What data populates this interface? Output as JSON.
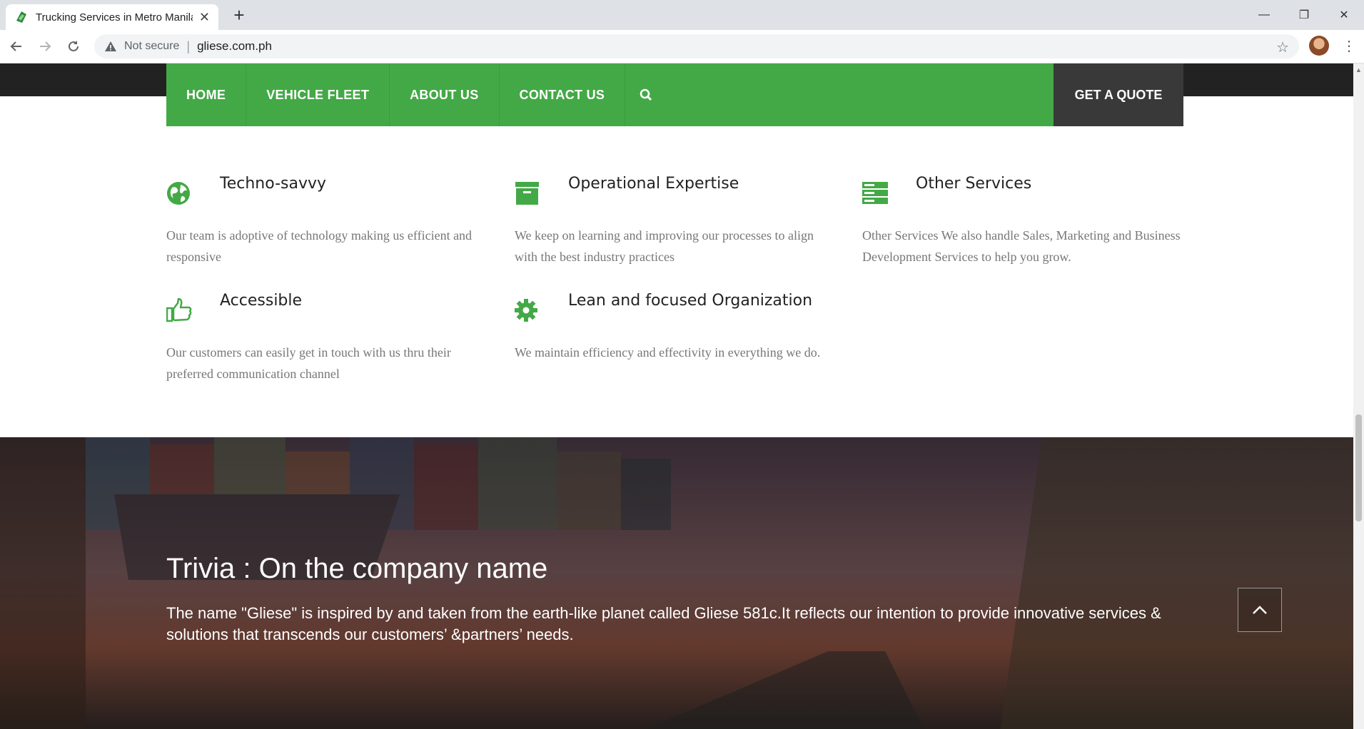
{
  "browser": {
    "tab_title": "Trucking Services in Metro Manila",
    "tab_close": "✕",
    "new_tab": "+",
    "not_secure": "Not secure",
    "separator": "|",
    "url": "gliese.com.ph",
    "controls": {
      "minimize": "—",
      "restore": "❐",
      "close": "✕"
    },
    "menu": "⋮",
    "bookmark": "☆"
  },
  "colors": {
    "brand_green": "#43a946",
    "dark": "#393939",
    "muted_text": "#777777"
  },
  "nav": {
    "items": [
      {
        "label": "HOME"
      },
      {
        "label": "VEHICLE FLEET"
      },
      {
        "label": "ABOUT US"
      },
      {
        "label": "CONTACT US"
      }
    ],
    "search_icon": "search-icon",
    "quote_label": "GET A QUOTE"
  },
  "features": [
    {
      "icon": "globe-icon",
      "title": "Techno-savvy",
      "text": "Our team is adoptive of technology making us efficient and responsive"
    },
    {
      "icon": "archive-box-icon",
      "title": "Operational Expertise",
      "text": "We keep on learning and improving our processes to align with the best industry practices"
    },
    {
      "icon": "server-stack-icon",
      "title": "Other Services",
      "text": "Other Services We also handle Sales, Marketing and Business Development Services to help you grow."
    },
    {
      "icon": "thumbs-up-icon",
      "title": "Accessible",
      "text": "Our customers can easily get in touch with us thru their preferred communication channel"
    },
    {
      "icon": "gear-icon",
      "title": "Lean and focused Organization",
      "text": "We maintain efficiency and effectivity in everything we do."
    }
  ],
  "trivia": {
    "title": "Trivia : On the company name",
    "text": "The name \"Gliese\" is inspired by and taken from the earth-like planet called Gliese 581c.It reflects our intention to provide innovative services & solutions that transcends our customers’ &partners’ needs."
  }
}
